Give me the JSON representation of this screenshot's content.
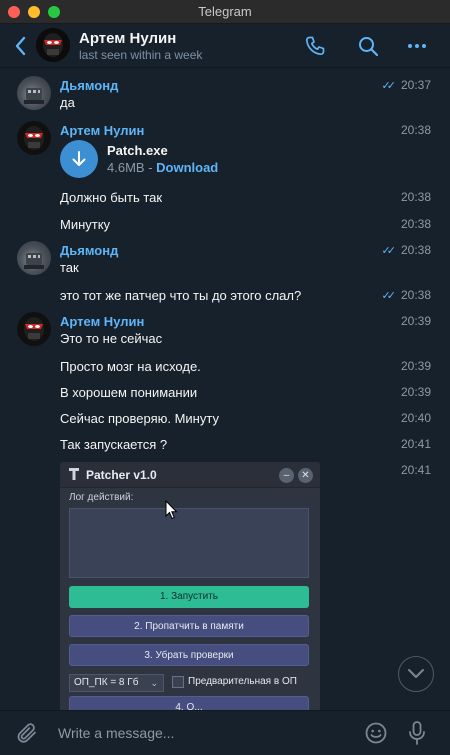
{
  "window": {
    "title": "Telegram"
  },
  "header": {
    "name": "Артем Нулин",
    "status": "last seen within a week",
    "icons": [
      "back-chevron-icon",
      "phone-icon",
      "search-icon",
      "more-icon"
    ]
  },
  "messages": [
    {
      "sender": "Дьямонд",
      "text": "да",
      "time": "20:37",
      "read": true
    },
    {
      "sender": "Артем Нулин",
      "file": {
        "name": "Patch.exe",
        "size": "4.6MB",
        "sep": " - ",
        "action": "Download"
      },
      "time": "20:38"
    },
    {
      "text": "Должно быть так",
      "time": "20:38"
    },
    {
      "text": "Минутку",
      "time": "20:38"
    },
    {
      "sender": "Дьямонд",
      "text": "так",
      "time": "20:38",
      "read": true
    },
    {
      "text": "это тот же патчер что ты до этого слал?",
      "time": "20:38",
      "read": true
    },
    {
      "sender": "Артем Нулин",
      "text": "Это то не сейчас",
      "time": "20:39"
    },
    {
      "text": "Просто мозг на исходе.",
      "time": "20:39"
    },
    {
      "text": "В хорошем понимании",
      "time": "20:39"
    },
    {
      "text": "Сейчас проверяю. Минуту",
      "time": "20:40"
    },
    {
      "text": "Так запускается ?",
      "time": "20:41"
    },
    {
      "time": "20:41"
    }
  ],
  "patcher": {
    "title": "Patcher v1.0",
    "min_label": "–",
    "close_label": "✕",
    "log_label": "Лог действий:",
    "btn_run": "1. Запустить",
    "btn_patch": "2. Пропатчить в памяти",
    "btn_checks": "3. Убрать проверки",
    "select_value": "ОП_ПК = 8 Гб",
    "checkbox_label": "Предварительная в ОП",
    "btn_next": "4. О..."
  },
  "composer": {
    "placeholder": "Write a message..."
  },
  "colors": {
    "accent": "#5eb5f7",
    "background": "#17212b",
    "run_button": "#2ebc95"
  }
}
